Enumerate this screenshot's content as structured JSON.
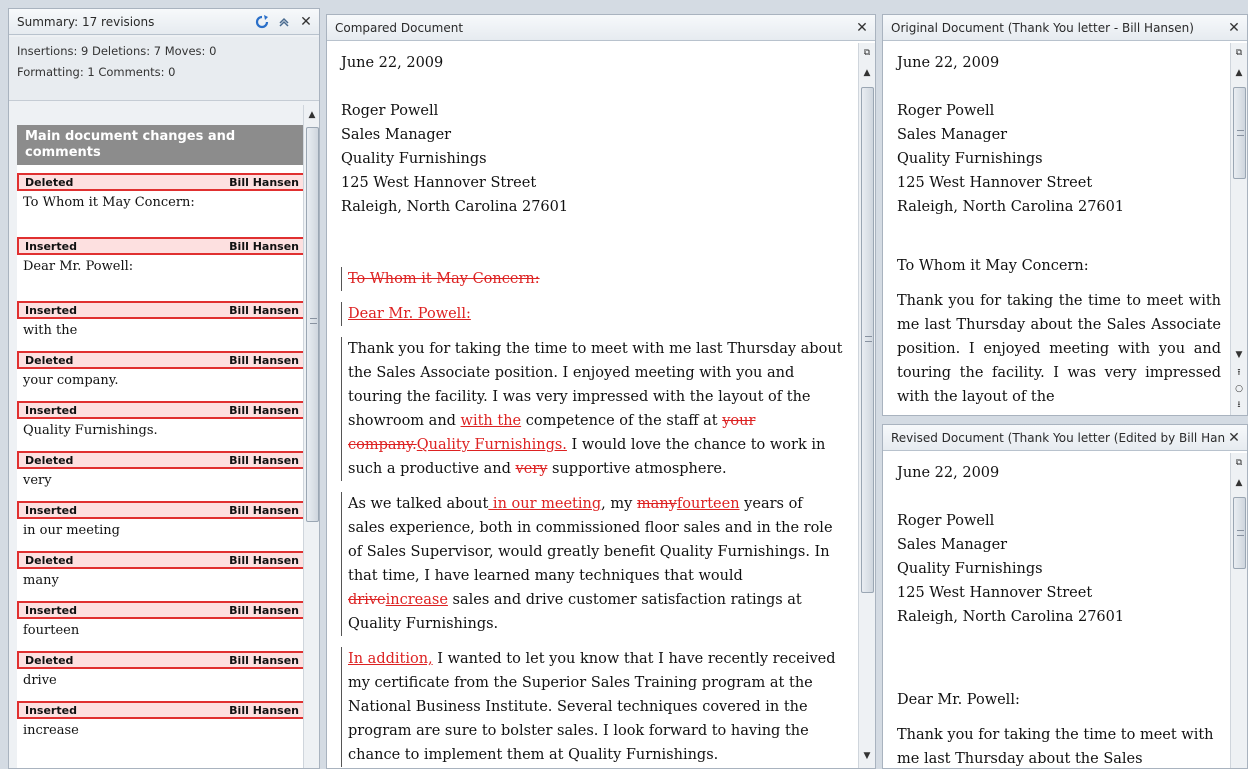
{
  "summary": {
    "title": "Summary: 17 revisions",
    "stats_line1": "Insertions: 9  Deletions: 7  Moves: 0",
    "stats_line2": "Formatting: 1  Comments: 0",
    "group_title": "Main document changes and comments",
    "items": [
      {
        "type": "Deleted",
        "author": "Bill Hansen",
        "text": "To Whom it May Concern:"
      },
      {
        "type": "Inserted",
        "author": "Bill Hansen",
        "text": "Dear Mr. Powell:"
      },
      {
        "type": "Inserted",
        "author": "Bill Hansen",
        "text": "with the"
      },
      {
        "type": "Deleted",
        "author": "Bill Hansen",
        "text": "your company."
      },
      {
        "type": "Inserted",
        "author": "Bill Hansen",
        "text": "Quality Furnishings."
      },
      {
        "type": "Deleted",
        "author": "Bill Hansen",
        "text": "very"
      },
      {
        "type": "Inserted",
        "author": "Bill Hansen",
        "text": "in our meeting"
      },
      {
        "type": "Deleted",
        "author": "Bill Hansen",
        "text": "many"
      },
      {
        "type": "Inserted",
        "author": "Bill Hansen",
        "text": "fourteen"
      },
      {
        "type": "Deleted",
        "author": "Bill Hansen",
        "text": "drive"
      },
      {
        "type": "Inserted",
        "author": "Bill Hansen",
        "text": "increase"
      }
    ]
  },
  "compared": {
    "title": "Compared Document",
    "date": "June 22, 2009",
    "addr1": "Roger Powell",
    "addr2": "Sales Manager",
    "addr3": "Quality Furnishings",
    "addr4": "125 West Hannover Street",
    "addr5": "Raleigh, North Carolina 27601",
    "deleted_salutation": "To Whom it May Concern:",
    "inserted_salutation": "Dear Mr. Powell:",
    "p1_a": "Thank you for taking the time to meet with me last Thursday about the Sales Associate position. I enjoyed meeting with you and touring the facility. I was very impressed with the layout of the showroom and ",
    "p1_ins1": "with the",
    "p1_b": " competence of the staff at ",
    "p1_del1": "your company.",
    "p1_ins2": "Quality Furnishings.",
    "p1_c": " I would love the chance to work in such a productive and ",
    "p1_del2": "very",
    "p1_d": " supportive atmosphere.",
    "p2_a": "As we talked about",
    "p2_ins1": " in our meeting",
    "p2_b": ", my ",
    "p2_del1": "many",
    "p2_ins2": "fourteen",
    "p2_c": " years of sales experience, both in commissioned floor sales and in the role of Sales Supervisor, would greatly benefit Quality Furnishings. In that time, I have learned many techniques that would ",
    "p2_del2": "drive",
    "p2_ins3": "increase",
    "p2_d": " sales and drive customer satisfaction ratings at Quality Furnishings.",
    "p3_ins": "In addition,",
    "p3_a": " I wanted to let you know that I have recently received my certificate from the Superior Sales Training program at the National Business Institute. Several techniques covered in the program are sure to bolster sales. I look forward to having the chance to implement them at Quality Furnishings."
  },
  "original": {
    "title": "Original Document (Thank You letter - Bill Hansen)",
    "date": "June 22, 2009",
    "addr1": "Roger Powell",
    "addr2": "Sales Manager",
    "addr3": "Quality Furnishings",
    "addr4": "125 West Hannover Street",
    "addr5": "Raleigh, North Carolina 27601",
    "salutation": "To Whom it May Concern:",
    "body": "Thank you for taking the time to meet with me last Thursday about the Sales Associate position. I enjoyed meeting with you and touring the facility. I was very impressed with the layout of the"
  },
  "revised": {
    "title": "Revised Document (Thank You letter (Edited by Bill Hansen))",
    "date": "June 22, 2009",
    "addr1": "Roger Powell",
    "addr2": "Sales Manager",
    "addr3": "Quality Furnishings",
    "addr4": "125 West Hannover Street",
    "addr5": "Raleigh, North Carolina 27601",
    "salutation": "Dear Mr. Powell:",
    "body": "Thank you for taking the time to meet with me last Thursday about the Sales"
  },
  "colors": {
    "revision_red": "#d22222",
    "tag_fill": "#fde0e0",
    "group_gray": "#8c8c8c"
  }
}
